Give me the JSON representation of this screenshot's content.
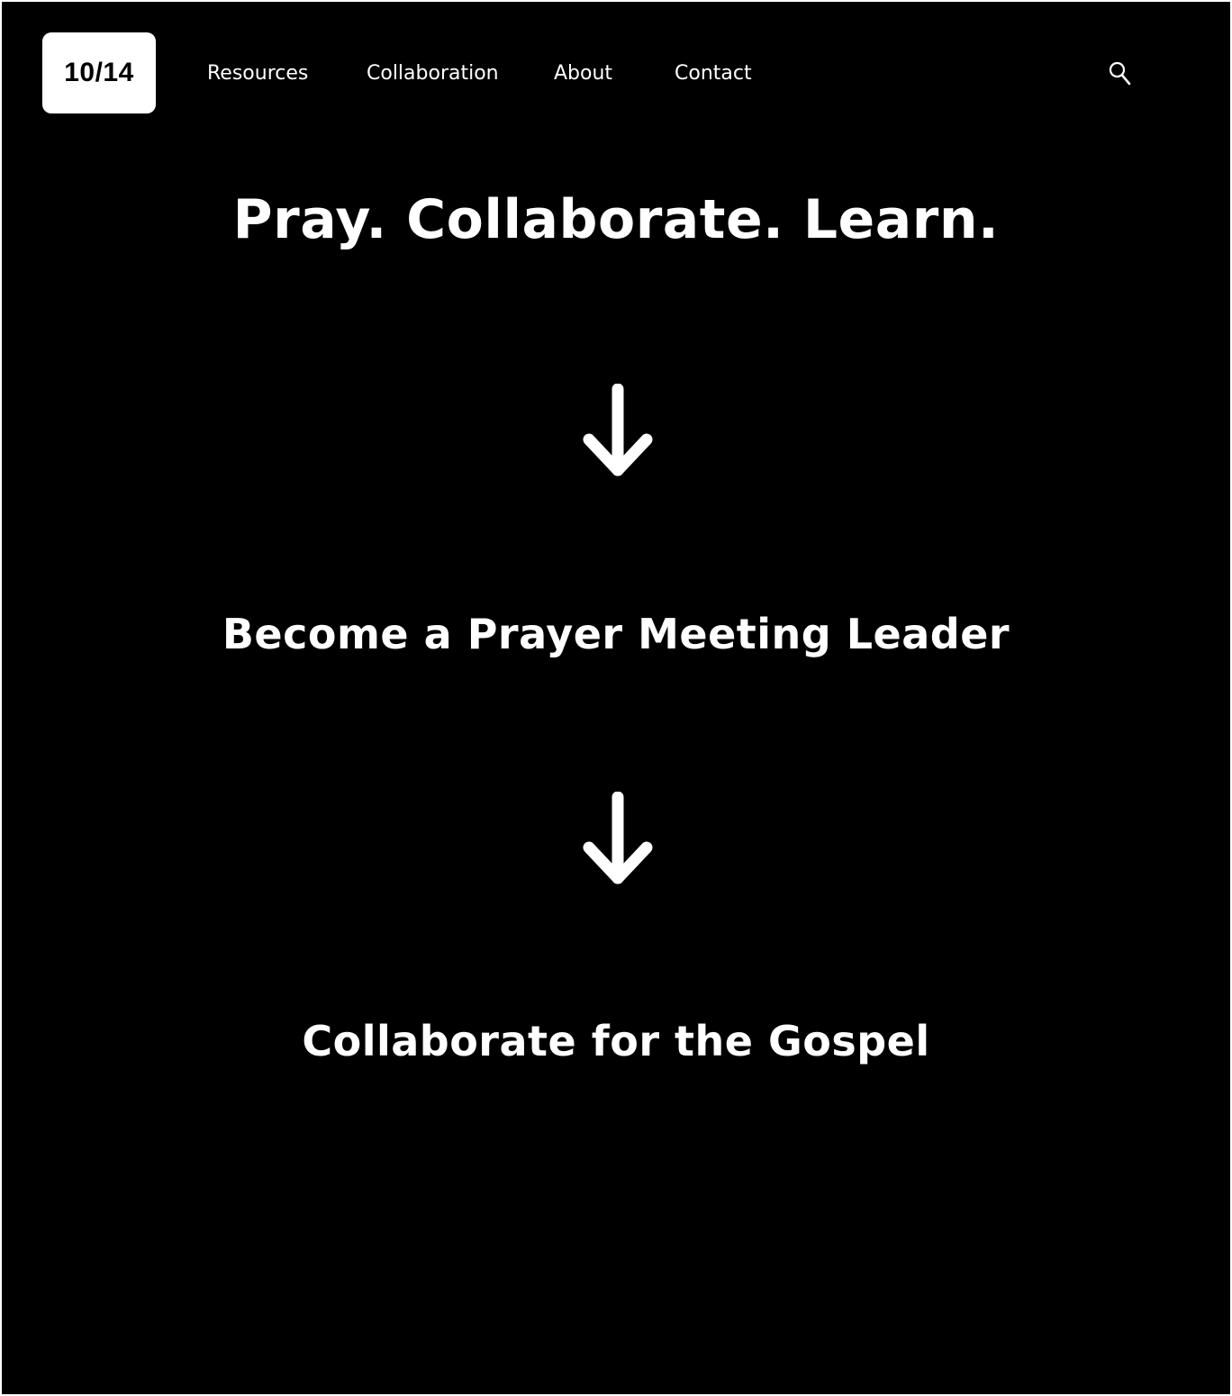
{
  "header": {
    "logo_text": "10/14",
    "nav": [
      {
        "label": "Resources"
      },
      {
        "label": "Collaboration"
      },
      {
        "label": "About"
      },
      {
        "label": "Contact"
      }
    ],
    "search_icon": "search-icon"
  },
  "hero": {
    "title": "Pray. Collaborate. Learn.",
    "steps": [
      {
        "label": "Become a Prayer Meeting Leader",
        "arrow_icon": "arrow-down-icon"
      },
      {
        "label": "Collaborate for the Gospel",
        "arrow_icon": "arrow-down-icon"
      }
    ]
  },
  "colors": {
    "background": "#000000",
    "text": "#ffffff",
    "logo_background": "#ffffff",
    "logo_text": "#000000"
  }
}
